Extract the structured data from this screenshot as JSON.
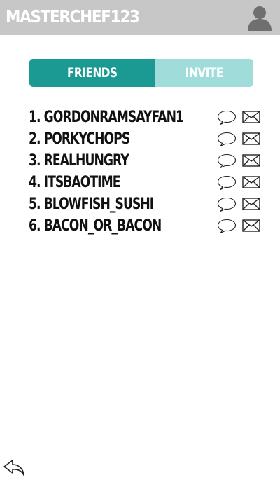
{
  "header": {
    "title": "MASTERCHEF123",
    "profile_icon": "user-icon"
  },
  "tabs": [
    {
      "label": "FRIENDS",
      "active": true,
      "color": "#1a9a92"
    },
    {
      "label": "INVITE",
      "active": false,
      "color": "#9fdcda"
    }
  ],
  "friends": [
    {
      "rank": "1.",
      "name": "GORDONRAMSAYFAN1",
      "label": "1. GORDONRAMSAYFAN1"
    },
    {
      "rank": "2.",
      "name": "PORKYCHOPS",
      "label": "2. PORKYCHOPS"
    },
    {
      "rank": "3.",
      "name": "REALHUNGRY",
      "label": "3. REALHUNGRY"
    },
    {
      "rank": "4.",
      "name": "ITSBAOTIME",
      "label": "4. ITSBAOTIME"
    },
    {
      "rank": "5.",
      "name": "BLOWFISH_SUSHI",
      "label": "5. BLOWFISH_SUSHI"
    },
    {
      "rank": "6.",
      "name": "BACON_OR_BACON",
      "label": "6. BACON_OR_BACON"
    }
  ],
  "row_icons": {
    "chat": "chat-bubble-icon",
    "mail": "envelope-icon"
  },
  "footer": {
    "back_icon": "reply-arrow-icon"
  },
  "colors": {
    "header_bg": "#c7c7c7",
    "accent": "#1a9a92",
    "accent_light": "#9fdcda"
  }
}
